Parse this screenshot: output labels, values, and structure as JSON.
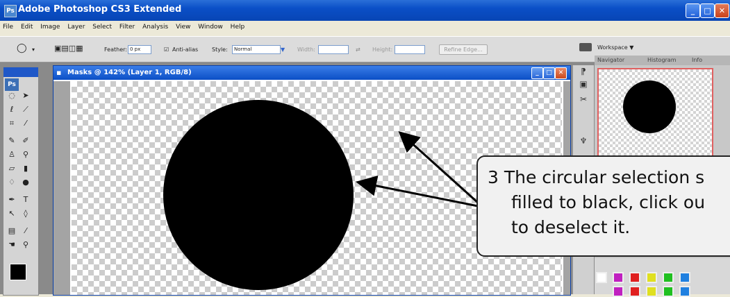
{
  "app": {
    "title": "Adobe Photoshop CS3 Extended",
    "icon": "photoshop-app-icon"
  },
  "window_controls": [
    "minimize-icon",
    "maximize-icon",
    "close-icon"
  ],
  "menu": [
    "File",
    "Edit",
    "Image",
    "Layer",
    "Select",
    "Filter",
    "Analysis",
    "View",
    "Window",
    "Help"
  ],
  "options_bar": {
    "feather_label": "Feather:",
    "feather_value": "0 px",
    "antialias_label": "Anti-alias",
    "antialias_checked": true,
    "style_label": "Style:",
    "style_value": "Normal",
    "width_label": "Width:",
    "height_label": "Height:",
    "refine_label": "Refine Edge..."
  },
  "workspace": {
    "label": "Workspace ▼"
  },
  "toolbox": {
    "logo": "Ps",
    "foreground_color": "#000000"
  },
  "document": {
    "title": "Masks @ 142% (Layer 1, RGB/8)"
  },
  "panel_tabs": [
    "Navigator",
    "Histogram",
    "Info"
  ],
  "swatch_colors": [
    "#ffffff",
    "#c020c0",
    "#e02020",
    "#e0e020",
    "#20c020",
    "#2080e0"
  ],
  "callout": {
    "number": "3",
    "lines": [
      "3  The circular selection s",
      "filled to black, click ou",
      "to deselect it."
    ]
  }
}
